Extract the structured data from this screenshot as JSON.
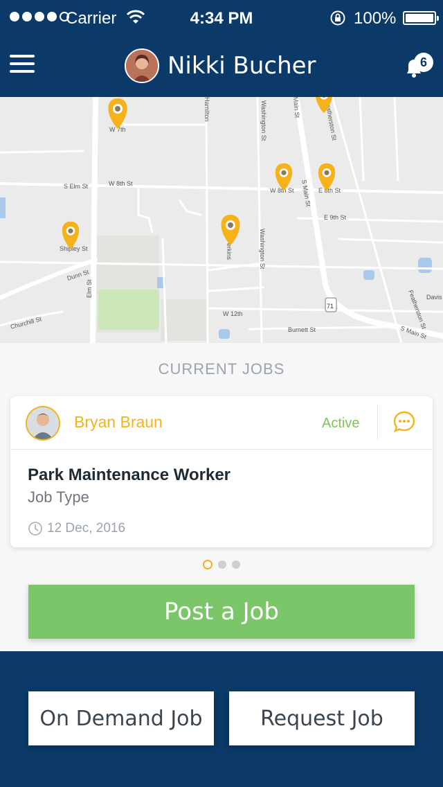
{
  "status_bar": {
    "carrier": "Carrier",
    "time": "4:34 PM",
    "battery": "100%",
    "battery_level": 1.0
  },
  "header": {
    "user_name": "Nikki Bucher",
    "notifications_count": "6"
  },
  "map": {
    "streets": [
      "W 7th",
      "S Elm St",
      "W 8th St",
      "W 8th St",
      "E 8th St",
      "E 9th St",
      "Shipley St",
      "Dunn St",
      "Elm St",
      "Washington St",
      "Washington St",
      "W 12th",
      "Burnett St",
      "Churchill St",
      "S Main St",
      "S Main St",
      "Hamilton",
      "Featherston St",
      "Featherston St",
      "Davis",
      "Main St",
      "Perkins"
    ],
    "route_shield": "71"
  },
  "current_jobs": {
    "title": "CURRENT JOBS",
    "job": {
      "worker_name": "Bryan Braun",
      "status": "Active",
      "title": "Park Maintenance Worker",
      "type": "Job Type",
      "date": "12 Dec, 2016"
    }
  },
  "actions": {
    "post_job": "Post a Job",
    "on_demand": "On Demand Job",
    "request": "Request Job"
  },
  "colors": {
    "primary": "#0b3a68",
    "accent": "#f5b21b",
    "success": "#7cc66a",
    "status_active": "#7cc35a"
  },
  "icons": [
    "signal-icon",
    "wifi-icon",
    "rotation-lock-icon",
    "battery-icon",
    "menu-icon",
    "bell-icon",
    "map-pin-icon",
    "chat-icon",
    "clock-icon"
  ]
}
